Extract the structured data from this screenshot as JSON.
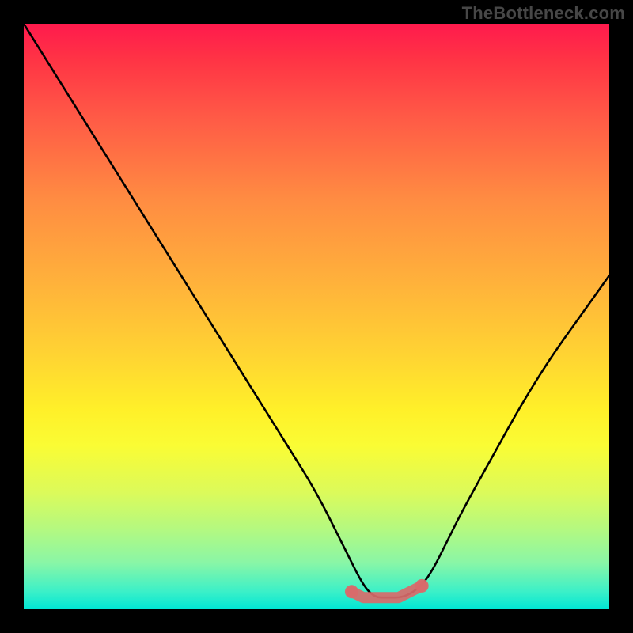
{
  "watermark": "TheBottleneck.com",
  "chart_data": {
    "type": "line",
    "title": "",
    "xlabel": "",
    "ylabel": "",
    "xlim": [
      0,
      100
    ],
    "ylim": [
      0,
      100
    ],
    "grid": false,
    "legend": false,
    "background_gradient": {
      "direction": "top-to-bottom",
      "stops": [
        {
          "pos": 0,
          "color": "#ff1a4d"
        },
        {
          "pos": 16,
          "color": "#ff5a46"
        },
        {
          "pos": 44,
          "color": "#ffb13b"
        },
        {
          "pos": 66,
          "color": "#fff029"
        },
        {
          "pos": 86,
          "color": "#b6f97e"
        },
        {
          "pos": 100,
          "color": "#00e6d4"
        }
      ]
    },
    "series": [
      {
        "name": "bottleneck-curve",
        "color": "#000000",
        "x": [
          0,
          5,
          10,
          15,
          20,
          25,
          30,
          35,
          40,
          45,
          50,
          55,
          58,
          60,
          62,
          65,
          68,
          70,
          72,
          75,
          80,
          85,
          90,
          95,
          100
        ],
        "y": [
          100,
          92,
          84,
          76,
          68,
          60,
          52,
          44,
          36,
          28,
          20,
          10,
          4,
          2,
          2,
          2,
          4,
          7,
          11,
          17,
          26,
          35,
          43,
          50,
          57
        ]
      },
      {
        "name": "highlight-dots",
        "color": "#d96a6a",
        "type": "scatter",
        "x": [
          56,
          58,
          60,
          62,
          64,
          66,
          68
        ],
        "y": [
          3,
          2,
          2,
          2,
          2,
          3,
          4
        ]
      }
    ],
    "annotations": []
  }
}
